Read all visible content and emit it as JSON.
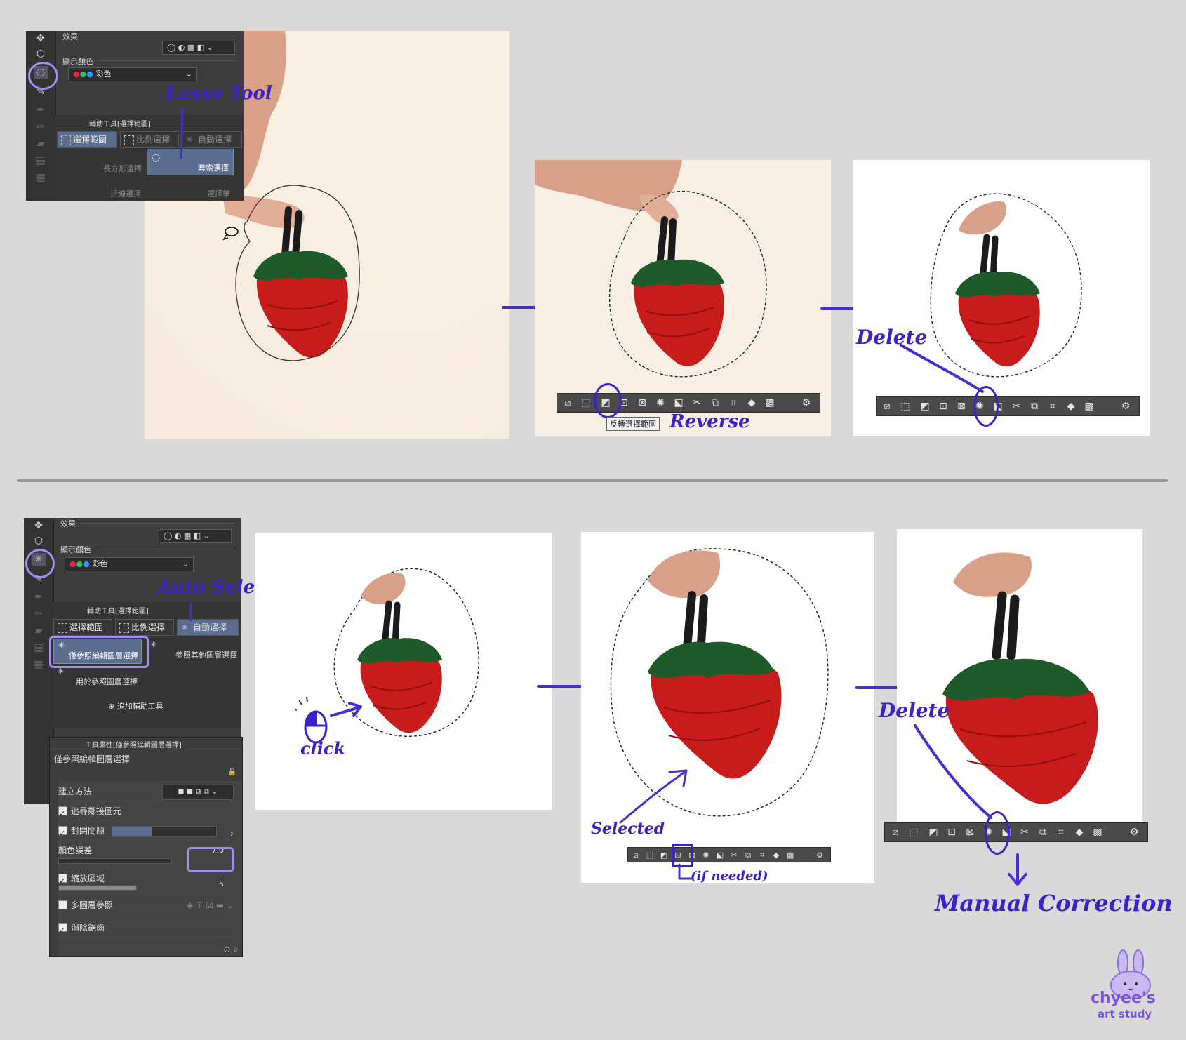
{
  "colors": {
    "background": "#d9d9d9",
    "panel": "#3d3d3d",
    "accent_tab": "#5b6e8f",
    "annotation": "#3b22c8",
    "highlight_circle": "#a38df0",
    "strawberry": "#cc1d1d",
    "leaves": "#1e5a2c"
  },
  "top_panel": {
    "effect_label": "效果",
    "display_color_label": "顯示顏色",
    "color_mode": "彩色",
    "subtool_header": "輔助工具[選擇範圍]",
    "tabs": [
      "選擇範圍",
      "比例選擇",
      "自動選擇"
    ],
    "tools": [
      "長方形選擇",
      "套索選擇",
      "折線選擇",
      "選擇筆"
    ]
  },
  "bottom_panel": {
    "effect_label": "效果",
    "display_color_label": "顯示顏色",
    "color_mode": "彩色",
    "subtool_header": "輔助工具[選擇範圍]",
    "tabs": [
      "選擇範圍",
      "比例選擇",
      "自動選擇"
    ],
    "tools": [
      "僅參照編輯圖層選擇",
      "參照其他圖層選擇",
      "用於參照圖層選擇"
    ],
    "add_subtool": "追加輔助工具",
    "property_header": "工具屬性[僅參照編輯圖層選擇]",
    "property_title": "僅參照編輯圖層選擇",
    "rows": {
      "creation_method": "建立方法",
      "follow_adjacent": "追尋鄰接圖元",
      "close_gap": "封閉間隙",
      "color_tolerance": "顏色誤差",
      "tolerance_value": "7.0",
      "expand_area": "縮放區域",
      "expand_value": "5",
      "multi_layer": "多圖層參照",
      "antialias": "消除鋸齒"
    }
  },
  "icons": [
    "move-icon",
    "object-icon",
    "lasso-icon",
    "auto-select-icon",
    "eyedropper-icon",
    "pen-icon",
    "brush-icon",
    "eraser-icon",
    "fill-icon",
    "gradient-icon"
  ],
  "tooltip": {
    "reverse": "反轉選擇範圍"
  },
  "annotations": {
    "lasso_tool": "Lasso Tool",
    "reverse": "Reverse",
    "delete_top": "Delete",
    "auto_select": "Auto Select",
    "click": "click",
    "selected": "Selected",
    "if_needed": "(if needed)",
    "delete_bottom": "Delete",
    "manual_correction": "Manual Correction"
  },
  "logo": {
    "line1": "chyee's",
    "line2": "art study"
  }
}
